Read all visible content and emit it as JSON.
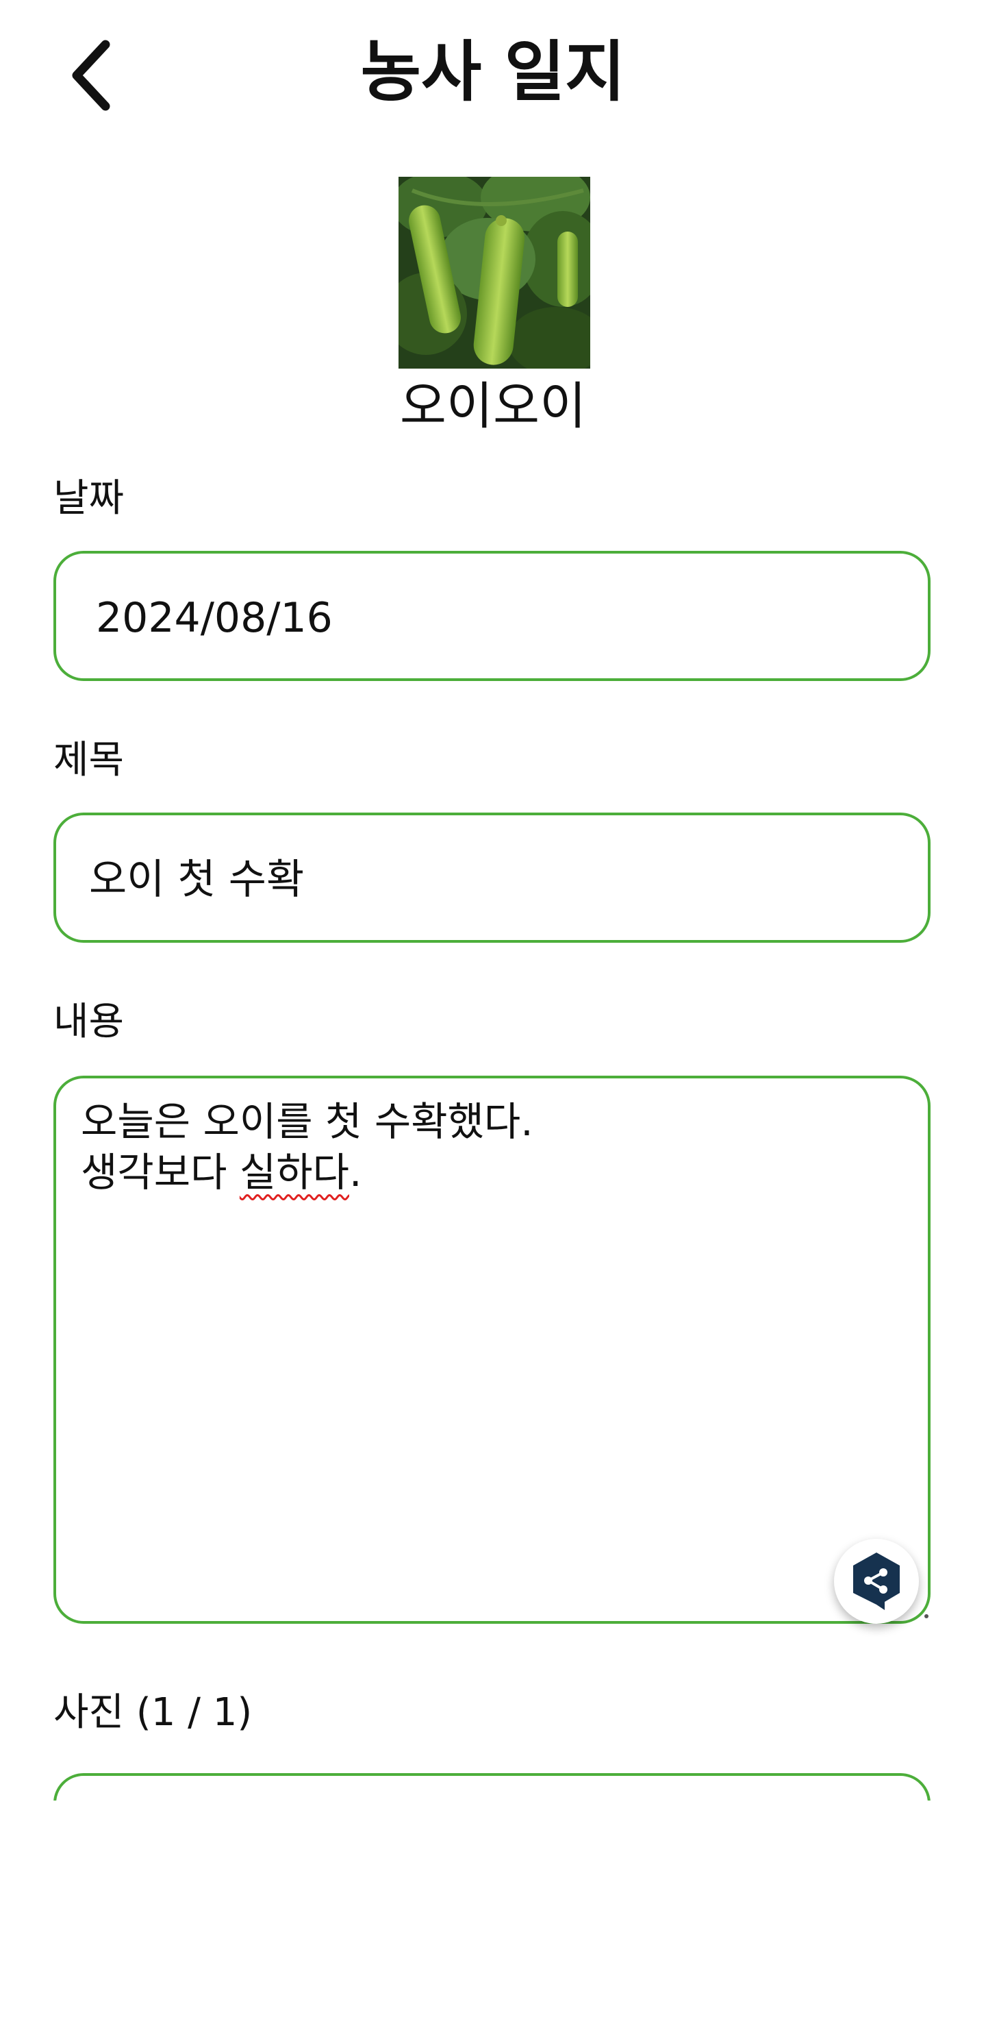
{
  "header": {
    "title": "농사 일지",
    "back_icon": "chevron-left-icon"
  },
  "crop": {
    "name": "오이오이",
    "photo_subject": "cucumber-photo"
  },
  "date_field": {
    "label": "날짜",
    "value": "2024/08/16"
  },
  "title_field": {
    "label": "제목",
    "value": "오이 첫 수확"
  },
  "content_field": {
    "label": "내용",
    "line1": "오늘은 오이를 첫 수확했다.",
    "line2_before": "생각보다 ",
    "line2_misspelled": "실하다",
    "line2_after": "."
  },
  "photos": {
    "label": "사진 (1 / 1)"
  },
  "colors": {
    "accent_border": "#4cae3a",
    "share_fab_icon": "#16324f"
  }
}
